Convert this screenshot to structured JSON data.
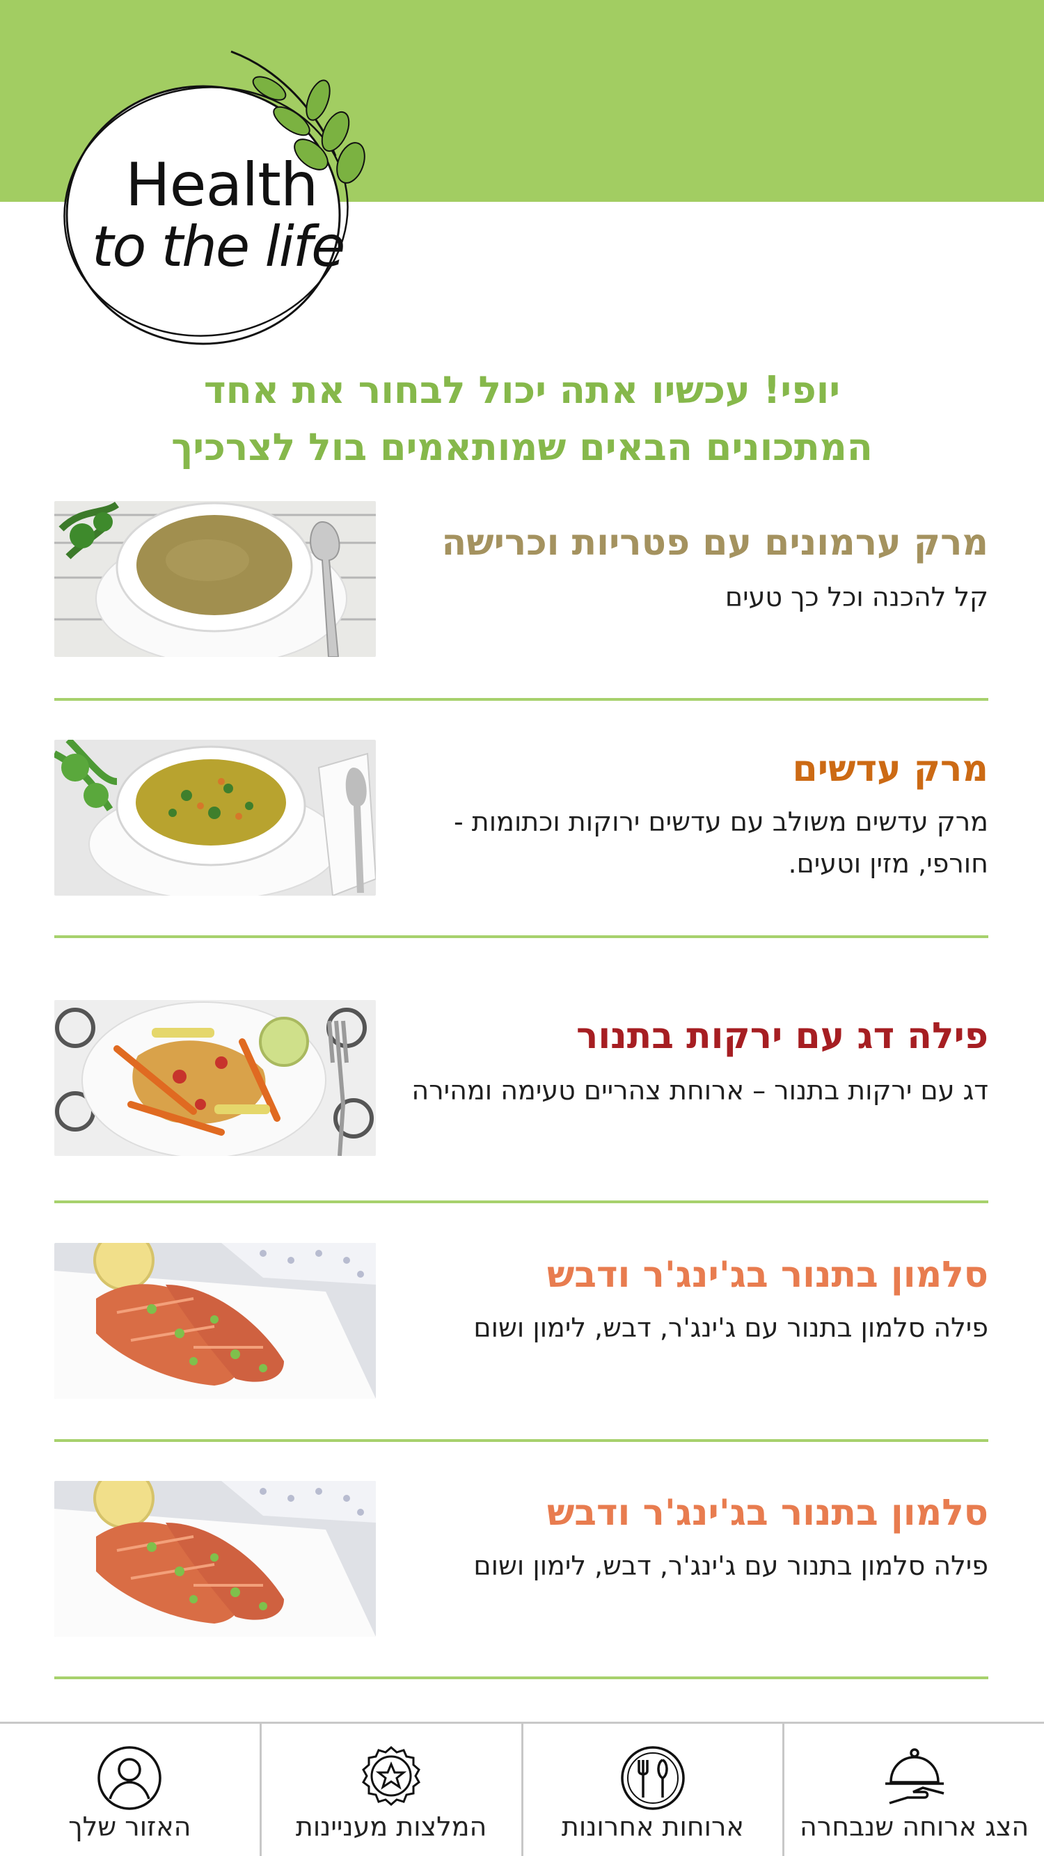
{
  "brand": {
    "line1": "Health",
    "line2": "to the life",
    "accent": "#a2cd62"
  },
  "intro": {
    "line1": "יופי! עכשיו אתה יכול לבחור את אחד",
    "line2": "המתכונים הבאים שמותאמים בול לצרכיך"
  },
  "recipes": [
    {
      "title": "מרק ערמונים עם פטריות וכרישה",
      "description": "קל להכנה וכל כך טעים",
      "title_color": "#a4925f",
      "image": "chestnut-soup-photo"
    },
    {
      "title": "מרק עדשים",
      "description": "מרק עדשים משולב עם עדשים ירוקות וכתומות - חורפי, מזין וטעים.",
      "title_color": "#cc6a14",
      "image": "lentil-soup-photo"
    },
    {
      "title": "פילה דג עם ירקות בתנור",
      "description": "דג עם ירקות בתנור – ארוחת צהריים טעימה ומהירה",
      "title_color": "#a61e22",
      "image": "fish-vegetables-photo"
    },
    {
      "title": "סלמון בתנור בג'ינג'ר ודבש",
      "description": "פילה סלמון בתנור עם ג'ינג'ר, דבש, לימון ושום",
      "title_color": "#e87c4f",
      "image": "salmon-photo"
    },
    {
      "title": "סלמון בתנור בג'ינג'ר ודבש",
      "description": "פילה סלמון בתנור עם ג'ינג'ר, דבש, לימון ושום",
      "title_color": "#e87c4f",
      "image": "salmon-photo"
    }
  ],
  "nav": [
    {
      "label": "האזור שלך",
      "icon": "user-icon"
    },
    {
      "label": "המלצות מעניינות",
      "icon": "star-badge-icon"
    },
    {
      "label": "ארוחות אחרונות",
      "icon": "utensils-icon"
    },
    {
      "label": "הצג ארוחה שנבחרה",
      "icon": "serving-dish-icon"
    }
  ]
}
